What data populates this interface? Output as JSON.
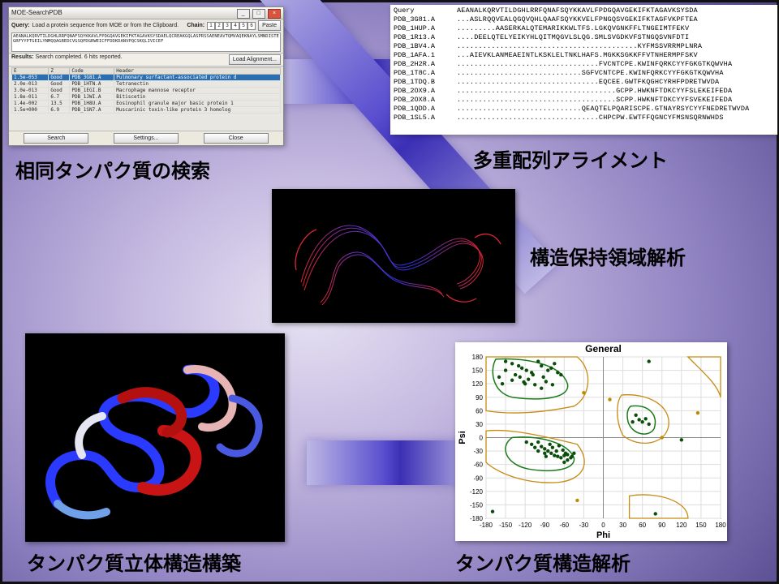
{
  "captions": {
    "c1": "相同タンパク質の検索",
    "c2": "多重配列アライメント",
    "c3": "構造保持領域解析",
    "c4": "タンパク質立体構造構築",
    "c5": "タンパク質構造解析"
  },
  "win": {
    "title": "MOE-SearchPDB",
    "query_label": "Query:",
    "query_hint": "Load a protein sequence from MOE or from the Clipboard.",
    "chain_label": "Chain:",
    "chains": [
      "1",
      "2",
      "3",
      "4",
      "5",
      "6"
    ],
    "paste": "Paste",
    "seq": "AEANALKQRVTILDGHLRRFQNAFSQYKKAVLFPDGQAVGEKIFKTAGAVKSYSDAELQCREAKGQLASPRSSAENEAVTQMVAQEKNAYLSMNDISTEGRFYYPTGEILYNMQQAGREDCVGSQPDGRWEICFFDDKDANVPQCSKQLIVICEF",
    "results_label": "Results:",
    "results_msg": "Search completed. 6 hits reported.",
    "load_align": "Load Alignment...",
    "cols": {
      "e": "E",
      "z": "Z",
      "code": "Code",
      "header": "Header"
    },
    "rows": [
      {
        "e": "1.5e-053",
        "z": "Good",
        "code": "PDB_3G81.A",
        "header": "Pulmonary surfactant-associated protein d"
      },
      {
        "e": "2.0e-013",
        "z": "Good",
        "code": "PDB_1HTN.A",
        "header": "Tetranectin"
      },
      {
        "e": "3.0e-013",
        "z": "Good",
        "code": "PDB_1EGI.B",
        "header": "Macrophage mannose receptor"
      },
      {
        "e": "1.8e-011",
        "z": "6.7",
        "code": "PDB_1JWI.A",
        "header": "Bitiscetin"
      },
      {
        "e": "1.4e-002",
        "z": "13.5",
        "code": "PDB_1H8U.A",
        "header": "Eosinophil granule major basic protein 1"
      },
      {
        "e": "1.5e+000",
        "z": "6.9",
        "code": "PDB_1SN7.A",
        "header": "Muscarinic toxin-like protein 3 homolog"
      }
    ],
    "footer": {
      "search": "Search",
      "settings": "Settings...",
      "close": "Close"
    }
  },
  "alignment": {
    "header": "Query",
    "query_seq": "AEANALKQRVTILDGHLRRFQNAFSQYKKAVLFPDGQAVGEKIFKTAGAVKSYSDA",
    "rows": [
      {
        "name": "PDB_3G81.A",
        "seq": "...ASLRQQVEALQGQVQHLQAAFSQYKKVELFPNGQSVGEKIFKTAGFVKPFTEA"
      },
      {
        "name": "PDB_1HUP.A",
        "seq": ".........AASERKALQTEMARIKKWLTFS.LGKQVGNKFFLTNGEIMTFEKV"
      },
      {
        "name": "PDB_1R13.A",
        "seq": "....DEELQTELYEIKYHLQITMQGVLSLQG.SMLSVGDKVFSTNGQSVNFDTI"
      },
      {
        "name": "PDB_1BV4.A",
        "seq": "..........................................KYFMSSVRRMPLNRA"
      },
      {
        "name": "PDB_1AFA.1",
        "seq": "...AIEVKLANMEAEINTLKSKLELTNKLHAFS.MGKKSGKKFFVTNHERMPFSKV"
      },
      {
        "name": "PDB_2H2R.A",
        "seq": ".................................FVCNTCPE.KWINFQRKCYYFGKGTKQWVHA"
      },
      {
        "name": "PDB_1T8C.A",
        "seq": ".............................SGFVCNTCPE.KWINFQRKCYYFGKGTKQWVHA"
      },
      {
        "name": "PDB_1TDQ.B",
        "seq": ".................................EQCEE.GWTFKQGHCYRHFPDRETWVDA"
      },
      {
        "name": "PDB_2OX9.A",
        "seq": ".....................................GCPP.HWKNFTDKCYYFSLEKEIFEDA"
      },
      {
        "name": "PDB_2OX8.A",
        "seq": ".....................................SCPP.HWKNFTDKCYYFSVEKEIFEDA"
      },
      {
        "name": "PDB_1QDD.A",
        "seq": ".............................QEAQTELPQARISCPE.GTNAYRSYCYYFNEDRETWVDA"
      },
      {
        "name": "PDB_1SL5.A",
        "seq": ".................................CHPCPW.EWTFFQGNCYFMSNSQRNWHDS"
      }
    ]
  },
  "chart_data": {
    "type": "scatter",
    "title": "General",
    "xlabel": "Phi",
    "ylabel": "Psi",
    "xlim": [
      -180,
      180
    ],
    "ylim": [
      -180,
      180
    ],
    "xticks": [
      -180,
      -150,
      -120,
      -90,
      -60,
      -30,
      0,
      30,
      60,
      90,
      120,
      150,
      180
    ],
    "yticks": [
      -180,
      -150,
      -120,
      -90,
      -60,
      -30,
      0,
      30,
      60,
      90,
      120,
      150,
      180
    ],
    "series": [
      {
        "name": "residues",
        "color": "#0b4d0b",
        "values": [
          [
            -140,
            165
          ],
          [
            -130,
            160
          ],
          [
            -125,
            155
          ],
          [
            -118,
            150
          ],
          [
            -110,
            145
          ],
          [
            -135,
            140
          ],
          [
            -128,
            135
          ],
          [
            -115,
            130
          ],
          [
            -140,
            128
          ],
          [
            -122,
            124
          ],
          [
            -100,
            170
          ],
          [
            -95,
            160
          ],
          [
            -85,
            150
          ],
          [
            -108,
            140
          ],
          [
            -92,
            135
          ],
          [
            -80,
            155
          ],
          [
            -75,
            165
          ],
          [
            -70,
            145
          ],
          [
            -150,
            150
          ],
          [
            -150,
            170
          ],
          [
            -120,
            120
          ],
          [
            -105,
            118
          ],
          [
            -95,
            110
          ],
          [
            -88,
            125
          ],
          [
            -78,
            118
          ],
          [
            -65,
            140
          ],
          [
            -160,
            135
          ],
          [
            -155,
            120
          ],
          [
            -100,
            -10
          ],
          [
            -95,
            -20
          ],
          [
            -90,
            -25
          ],
          [
            -85,
            -30
          ],
          [
            -80,
            -35
          ],
          [
            -75,
            -40
          ],
          [
            -70,
            -42
          ],
          [
            -65,
            -45
          ],
          [
            -60,
            -40
          ],
          [
            -58,
            -35
          ],
          [
            -82,
            -15
          ],
          [
            -78,
            -22
          ],
          [
            -72,
            -30
          ],
          [
            -68,
            -18
          ],
          [
            -62,
            -28
          ],
          [
            -55,
            -38
          ],
          [
            -50,
            -45
          ],
          [
            -90,
            -35
          ],
          [
            -88,
            -42
          ],
          [
            -100,
            -30
          ],
          [
            -110,
            -15
          ],
          [
            -105,
            -22
          ],
          [
            -118,
            -10
          ],
          [
            -60,
            -55
          ],
          [
            -55,
            -50
          ],
          [
            -48,
            -42
          ],
          [
            -45,
            -35
          ],
          [
            55,
            40
          ],
          [
            60,
            35
          ],
          [
            65,
            42
          ],
          [
            70,
            30
          ],
          [
            50,
            50
          ],
          [
            45,
            35
          ],
          [
            120,
            -5
          ],
          [
            80,
            -170
          ],
          [
            70,
            170
          ],
          [
            -170,
            -165
          ]
        ]
      },
      {
        "name": "outliers",
        "color": "#c08a00",
        "values": [
          [
            -30,
            100
          ],
          [
            10,
            85
          ],
          [
            145,
            55
          ],
          [
            90,
            0
          ],
          [
            -40,
            -140
          ]
        ]
      }
    ],
    "contours": [
      {
        "name": "favored-core",
        "color": "#1a7a1a",
        "regions": [
          "alpha",
          "beta",
          "Lalpha"
        ]
      },
      {
        "name": "allowed",
        "color": "#c78a12",
        "regions": [
          "alpha-ext",
          "beta-ext",
          "Lalpha-ext",
          "other"
        ]
      }
    ]
  }
}
